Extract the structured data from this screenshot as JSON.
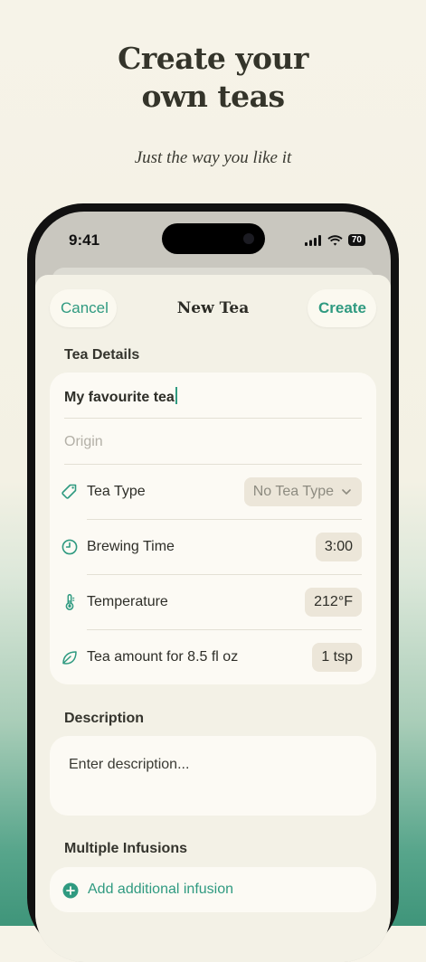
{
  "promo": {
    "headline_line1": "Create your",
    "headline_line2": "own teas",
    "tagline": "Just the way you like it"
  },
  "status_bar": {
    "time": "9:41",
    "battery": "70"
  },
  "nav": {
    "cancel_label": "Cancel",
    "title": "New Tea",
    "create_label": "Create"
  },
  "tea_details": {
    "section_label": "Tea Details",
    "name_value": "My favourite tea",
    "origin_placeholder": "Origin",
    "rows": [
      {
        "label": "Tea Type",
        "value": "No Tea Type",
        "icon": "tag-icon"
      },
      {
        "label": "Brewing Time",
        "value": "3:00",
        "icon": "clock-icon"
      },
      {
        "label": "Temperature",
        "value": "212°F",
        "icon": "thermometer-icon"
      },
      {
        "label": "Tea amount for 8.5 fl oz",
        "value": "1 tsp",
        "icon": "leaf-icon"
      }
    ]
  },
  "description": {
    "section_label": "Description",
    "placeholder": "Enter description..."
  },
  "infusions": {
    "section_label": "Multiple Infusions",
    "add_label": "Add additional infusion"
  },
  "colors": {
    "accent": "#2f9a80",
    "background": "#f3f1e6",
    "card": "#fcfaf4"
  }
}
